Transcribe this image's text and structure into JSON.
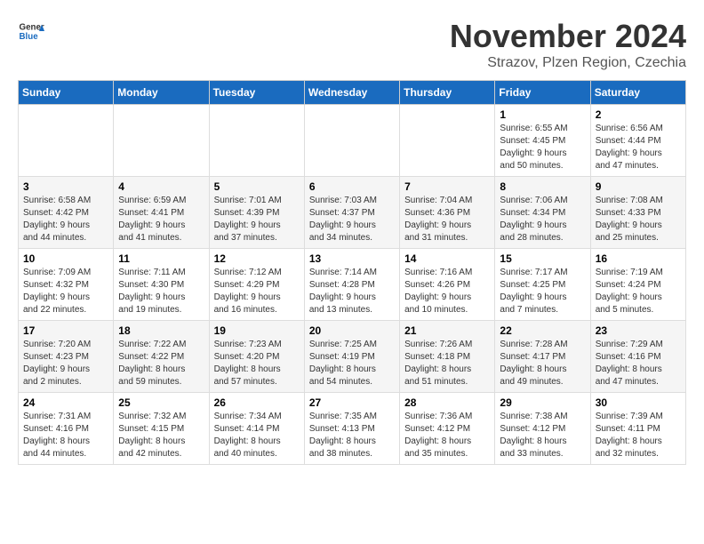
{
  "logo": {
    "text_general": "General",
    "text_blue": "Blue"
  },
  "title": "November 2024",
  "subtitle": "Strazov, Plzen Region, Czechia",
  "days_of_week": [
    "Sunday",
    "Monday",
    "Tuesday",
    "Wednesday",
    "Thursday",
    "Friday",
    "Saturday"
  ],
  "weeks": [
    [
      {
        "day": "",
        "info": ""
      },
      {
        "day": "",
        "info": ""
      },
      {
        "day": "",
        "info": ""
      },
      {
        "day": "",
        "info": ""
      },
      {
        "day": "",
        "info": ""
      },
      {
        "day": "1",
        "info": "Sunrise: 6:55 AM\nSunset: 4:45 PM\nDaylight: 9 hours\nand 50 minutes."
      },
      {
        "day": "2",
        "info": "Sunrise: 6:56 AM\nSunset: 4:44 PM\nDaylight: 9 hours\nand 47 minutes."
      }
    ],
    [
      {
        "day": "3",
        "info": "Sunrise: 6:58 AM\nSunset: 4:42 PM\nDaylight: 9 hours\nand 44 minutes."
      },
      {
        "day": "4",
        "info": "Sunrise: 6:59 AM\nSunset: 4:41 PM\nDaylight: 9 hours\nand 41 minutes."
      },
      {
        "day": "5",
        "info": "Sunrise: 7:01 AM\nSunset: 4:39 PM\nDaylight: 9 hours\nand 37 minutes."
      },
      {
        "day": "6",
        "info": "Sunrise: 7:03 AM\nSunset: 4:37 PM\nDaylight: 9 hours\nand 34 minutes."
      },
      {
        "day": "7",
        "info": "Sunrise: 7:04 AM\nSunset: 4:36 PM\nDaylight: 9 hours\nand 31 minutes."
      },
      {
        "day": "8",
        "info": "Sunrise: 7:06 AM\nSunset: 4:34 PM\nDaylight: 9 hours\nand 28 minutes."
      },
      {
        "day": "9",
        "info": "Sunrise: 7:08 AM\nSunset: 4:33 PM\nDaylight: 9 hours\nand 25 minutes."
      }
    ],
    [
      {
        "day": "10",
        "info": "Sunrise: 7:09 AM\nSunset: 4:32 PM\nDaylight: 9 hours\nand 22 minutes."
      },
      {
        "day": "11",
        "info": "Sunrise: 7:11 AM\nSunset: 4:30 PM\nDaylight: 9 hours\nand 19 minutes."
      },
      {
        "day": "12",
        "info": "Sunrise: 7:12 AM\nSunset: 4:29 PM\nDaylight: 9 hours\nand 16 minutes."
      },
      {
        "day": "13",
        "info": "Sunrise: 7:14 AM\nSunset: 4:28 PM\nDaylight: 9 hours\nand 13 minutes."
      },
      {
        "day": "14",
        "info": "Sunrise: 7:16 AM\nSunset: 4:26 PM\nDaylight: 9 hours\nand 10 minutes."
      },
      {
        "day": "15",
        "info": "Sunrise: 7:17 AM\nSunset: 4:25 PM\nDaylight: 9 hours\nand 7 minutes."
      },
      {
        "day": "16",
        "info": "Sunrise: 7:19 AM\nSunset: 4:24 PM\nDaylight: 9 hours\nand 5 minutes."
      }
    ],
    [
      {
        "day": "17",
        "info": "Sunrise: 7:20 AM\nSunset: 4:23 PM\nDaylight: 9 hours\nand 2 minutes."
      },
      {
        "day": "18",
        "info": "Sunrise: 7:22 AM\nSunset: 4:22 PM\nDaylight: 8 hours\nand 59 minutes."
      },
      {
        "day": "19",
        "info": "Sunrise: 7:23 AM\nSunset: 4:20 PM\nDaylight: 8 hours\nand 57 minutes."
      },
      {
        "day": "20",
        "info": "Sunrise: 7:25 AM\nSunset: 4:19 PM\nDaylight: 8 hours\nand 54 minutes."
      },
      {
        "day": "21",
        "info": "Sunrise: 7:26 AM\nSunset: 4:18 PM\nDaylight: 8 hours\nand 51 minutes."
      },
      {
        "day": "22",
        "info": "Sunrise: 7:28 AM\nSunset: 4:17 PM\nDaylight: 8 hours\nand 49 minutes."
      },
      {
        "day": "23",
        "info": "Sunrise: 7:29 AM\nSunset: 4:16 PM\nDaylight: 8 hours\nand 47 minutes."
      }
    ],
    [
      {
        "day": "24",
        "info": "Sunrise: 7:31 AM\nSunset: 4:16 PM\nDaylight: 8 hours\nand 44 minutes."
      },
      {
        "day": "25",
        "info": "Sunrise: 7:32 AM\nSunset: 4:15 PM\nDaylight: 8 hours\nand 42 minutes."
      },
      {
        "day": "26",
        "info": "Sunrise: 7:34 AM\nSunset: 4:14 PM\nDaylight: 8 hours\nand 40 minutes."
      },
      {
        "day": "27",
        "info": "Sunrise: 7:35 AM\nSunset: 4:13 PM\nDaylight: 8 hours\nand 38 minutes."
      },
      {
        "day": "28",
        "info": "Sunrise: 7:36 AM\nSunset: 4:12 PM\nDaylight: 8 hours\nand 35 minutes."
      },
      {
        "day": "29",
        "info": "Sunrise: 7:38 AM\nSunset: 4:12 PM\nDaylight: 8 hours\nand 33 minutes."
      },
      {
        "day": "30",
        "info": "Sunrise: 7:39 AM\nSunset: 4:11 PM\nDaylight: 8 hours\nand 32 minutes."
      }
    ]
  ]
}
